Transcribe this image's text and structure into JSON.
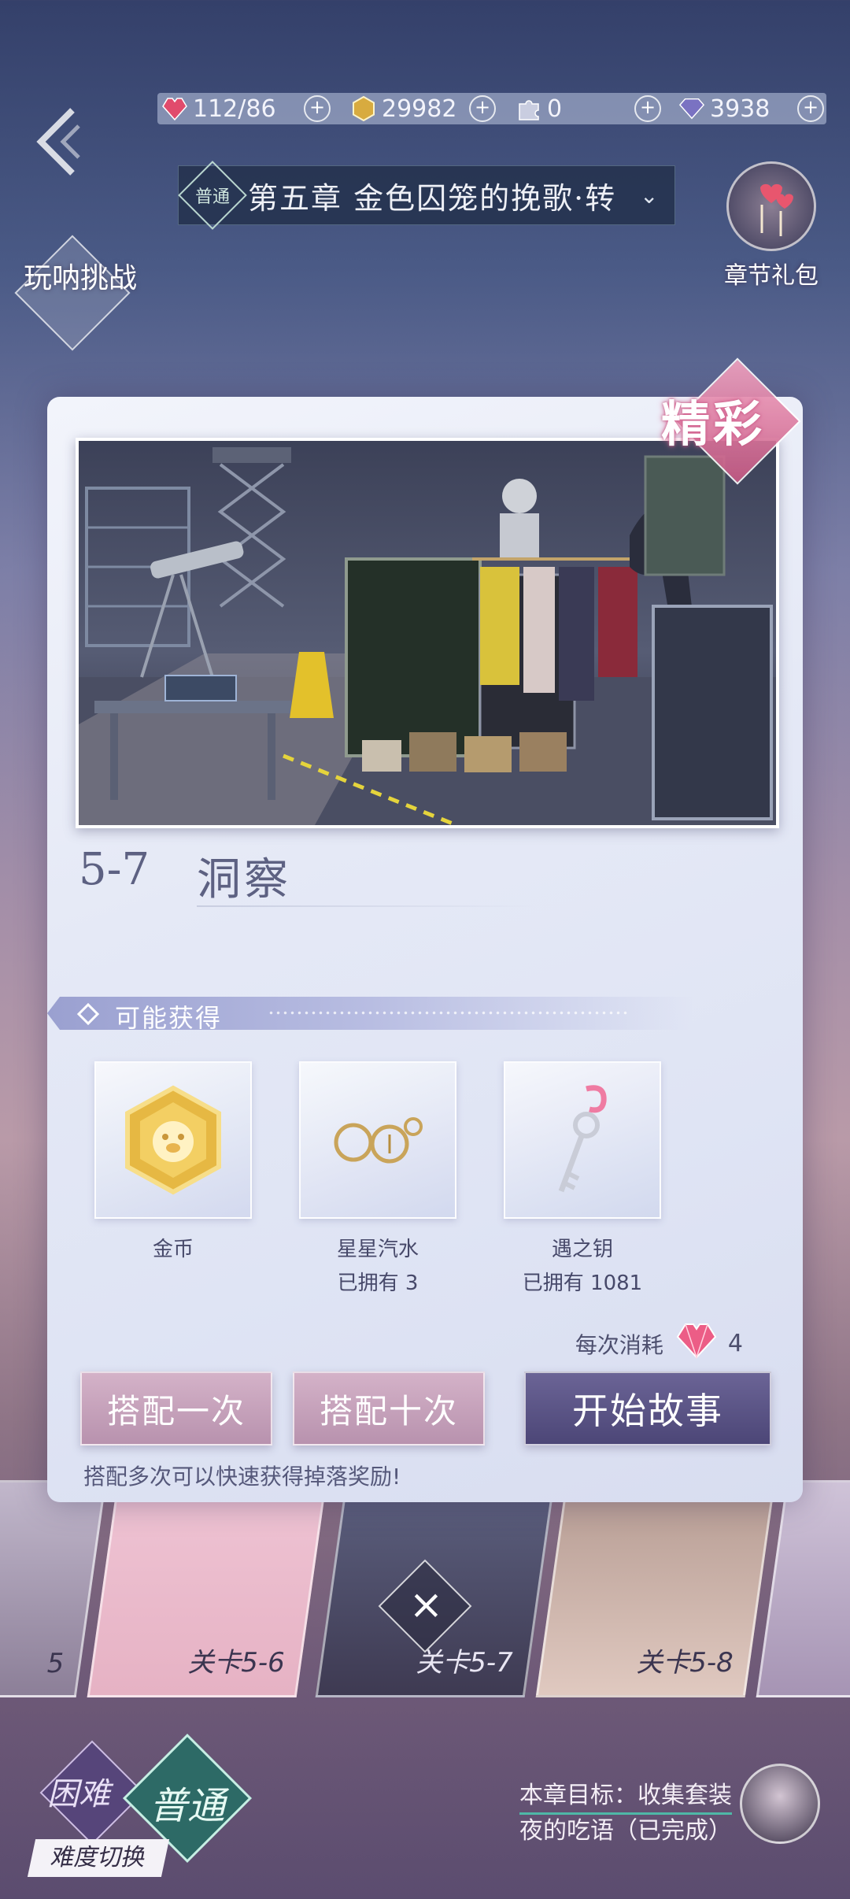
{
  "resources": {
    "stamina": "112/86",
    "coins": "29982",
    "puzzle": "0",
    "diamonds": "3938"
  },
  "chapter": {
    "mode_badge": "普通",
    "title": "第五章 金色囚笼的挽歌·转",
    "gift_label": "章节礼包",
    "challenge_label": "玩呐挑战"
  },
  "level": {
    "badge": "精彩",
    "number": "5-7",
    "name": "洞察"
  },
  "rewards": {
    "header": "可能获得",
    "items": [
      {
        "icon": "gold-coin-icon",
        "name": "金币",
        "owned": ""
      },
      {
        "icon": "star-soda-icon",
        "name": "星星汽水",
        "owned": "已拥有 3"
      },
      {
        "icon": "flamingo-key-icon",
        "name": "遇之钥",
        "owned": "已拥有 1081"
      }
    ]
  },
  "cost": {
    "label": "每次消耗",
    "value": "4"
  },
  "buttons": {
    "match_once": "搭配一次",
    "match_ten": "搭配十次",
    "start_story": "开始故事"
  },
  "hint": "搭配多次可以快速获得掉落奖励!",
  "stages": [
    {
      "label": "5"
    },
    {
      "label": "关卡5-6"
    },
    {
      "label": "关卡5-7"
    },
    {
      "label": "关卡5-8"
    }
  ],
  "close_symbol": "×",
  "difficulty": {
    "hard": "困难",
    "normal": "普通",
    "switch_label": "难度切换"
  },
  "goal": {
    "line1": "本章目标：收集套装",
    "line2": "夜的吃语（已完成）"
  },
  "colors": {
    "accent_pink": "#d96b98",
    "start_button": "#4c4677",
    "secondary_button": "#b892ae"
  }
}
